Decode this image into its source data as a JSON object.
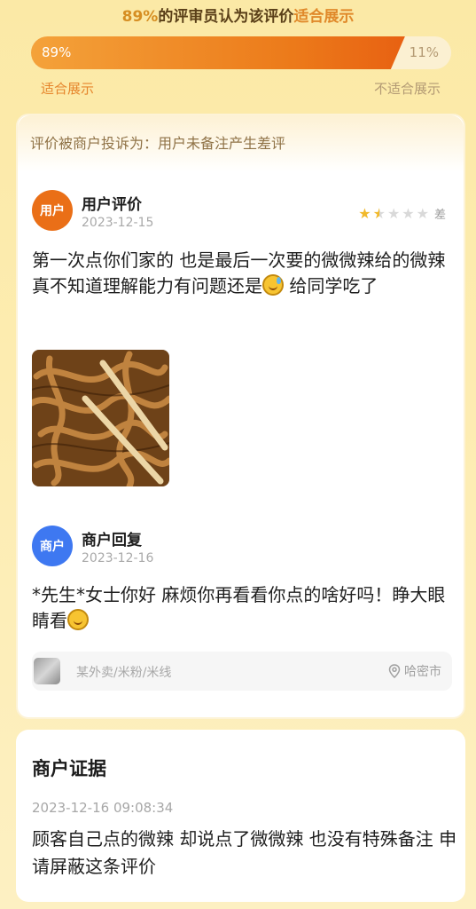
{
  "headline": {
    "pct": "89%",
    "middle": "的评审员认为该评价",
    "highlight": "适合展示"
  },
  "vote": {
    "agree_fraction": 0.89,
    "agree_label": "89%",
    "disagree_label": "11%",
    "yes_text": "适合展示",
    "no_text": "不适合展示"
  },
  "complaint": {
    "text": "评价被商户投诉为：用户未备注产生差评"
  },
  "review": {
    "avatar_text": "用户",
    "author": "用户评价",
    "date": "2023-12-15",
    "rating": 1.5,
    "rating_max": 5,
    "rating_word": "差",
    "text_before_emoji": "第一次点你们家的 也是最后一次要的微微辣给的微辣 真不知道理解能力有问题还是",
    "text_after_emoji": " 给同学吃了",
    "emoji_icon": "sweat-smile-emoji"
  },
  "reply": {
    "avatar_text": "商户",
    "author": "商户回复",
    "date": "2023-12-16",
    "text": "*先生*女士你好 麻烦你再看看你点的啥好吗！睁大眼睛看",
    "emoji_icon": "smiling-emoji"
  },
  "shop": {
    "category": "某外卖/米粉/米线",
    "location": "哈密市",
    "location_icon": "location-pin-icon"
  },
  "evidence": {
    "title": "商户证据",
    "time": "2023-12-16 09:08:34",
    "text": "顾客自己点的微辣 却说点了微微辣 也没有特殊备注 申请屏蔽这条评价"
  },
  "colors": {
    "accent": "#ec7a1a",
    "user_avatar": "#ea6f17",
    "shop_avatar": "#3e78f1",
    "star": "#f1b92b"
  }
}
